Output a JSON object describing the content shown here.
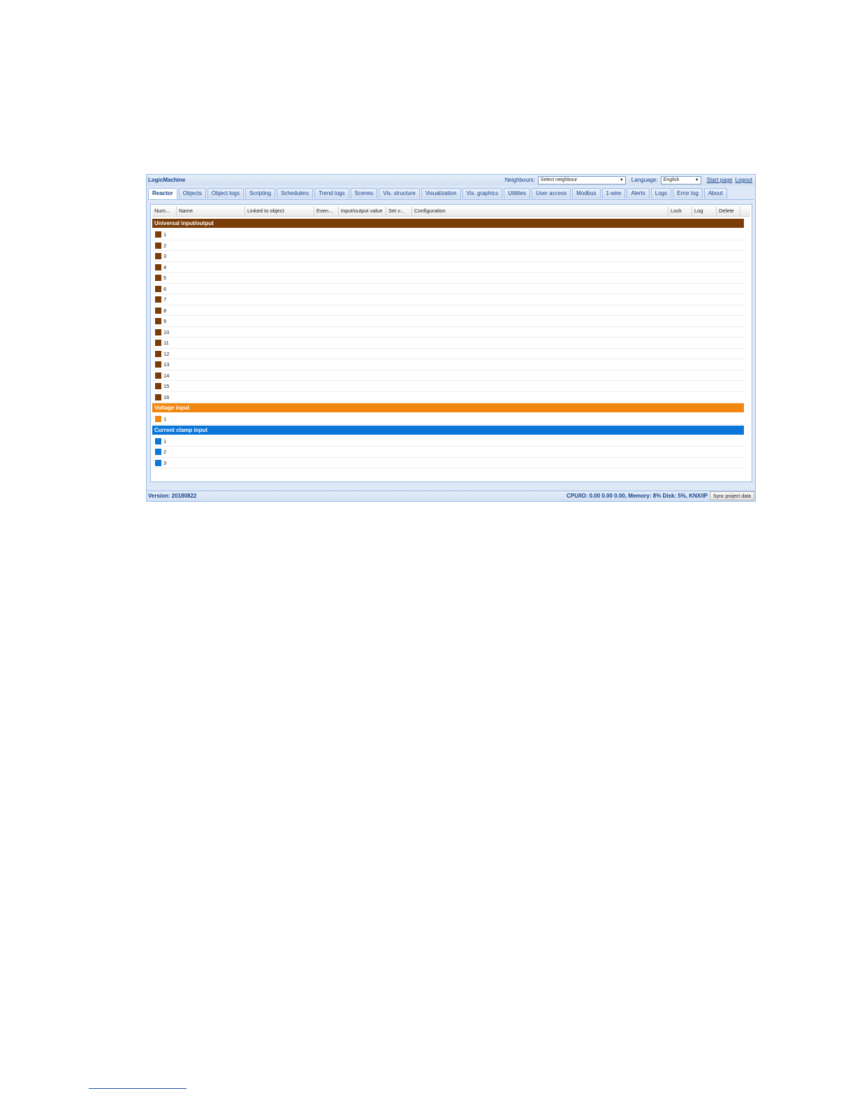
{
  "app": {
    "title": "LogicMachine"
  },
  "topbar": {
    "neighbours_label": "Neighbours:",
    "neighbours_value": "Select neighbour",
    "language_label": "Language:",
    "language_value": "English",
    "start_page": "Start page",
    "logout": "Logout"
  },
  "tabs": [
    "Reactor",
    "Objects",
    "Object logs",
    "Scripting",
    "Schedulers",
    "Trend logs",
    "Scenes",
    "Vis. structure",
    "Visualization",
    "Vis. graphics",
    "Utilities",
    "User access",
    "Modbus",
    "1-wire",
    "Alerts",
    "Logs",
    "Error log",
    "About"
  ],
  "active_tab": "Reactor",
  "grid": {
    "columns": [
      "Num...",
      "Name",
      "Linked to object",
      "Even...",
      "Input/output value",
      "Set v...",
      "Configuration",
      "Lock",
      "Log",
      "Delete"
    ],
    "groups": [
      {
        "title": "Universal input/output",
        "color": "#7a3d0a",
        "rows": [
          "1",
          "2",
          "3",
          "4",
          "5",
          "6",
          "7",
          "8",
          "9",
          "10",
          "11",
          "12",
          "13",
          "14",
          "15",
          "16"
        ]
      },
      {
        "title": "Voltage input",
        "color": "#f2870f",
        "rows": [
          "1"
        ]
      },
      {
        "title": "Current clamp input",
        "color": "#0a76d8",
        "rows": [
          "1",
          "2",
          "3"
        ]
      }
    ]
  },
  "status": {
    "version": "Version: 20180822",
    "sysinfo": "CPU/IO: 0.00 0.00 0.00, Memory: 8% Disk: 5%, KNX/IP",
    "sync_button": "Sync project data"
  }
}
